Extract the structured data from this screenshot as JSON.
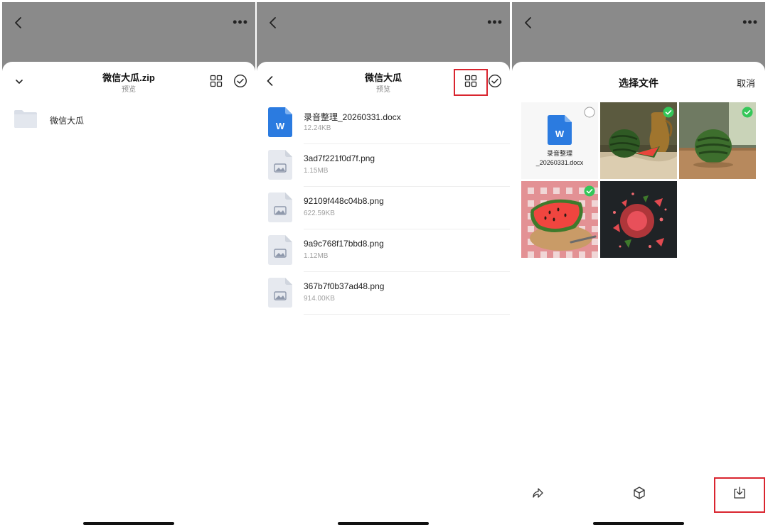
{
  "colors": {
    "accent_red": "#d9252f",
    "word_blue": "#2b7be0",
    "check_green": "#34c759",
    "overlay_gray": "#8a8a8a"
  },
  "icons": [
    "back-icon",
    "more-icon",
    "chevron-down-icon",
    "grid-view-icon",
    "select-check-icon",
    "folder-icon",
    "word-file-icon",
    "image-file-icon",
    "share-icon",
    "box-icon",
    "download-icon"
  ],
  "panel1": {
    "title": "微信大瓜.zip",
    "subtitle": "预览",
    "folder": {
      "name": "微信大瓜"
    }
  },
  "panel2": {
    "title": "微信大瓜",
    "subtitle": "预览",
    "files": [
      {
        "name": "录音整理_20260331.docx",
        "size": "12.24KB",
        "kind": "word"
      },
      {
        "name": "3ad7f221f0d7f.png",
        "size": "1.15MB",
        "kind": "image"
      },
      {
        "name": "92109f448c04b8.png",
        "size": "622.59KB",
        "kind": "image"
      },
      {
        "name": "9a9c768f17bbd8.png",
        "size": "1.12MB",
        "kind": "image"
      },
      {
        "name": "367b7f0b37ad48.png",
        "size": "914.00KB",
        "kind": "image"
      }
    ]
  },
  "panel3": {
    "title": "选择文件",
    "cancel": "取消",
    "doc_tile": {
      "line1": "录音整理",
      "line2": "_20260331.docx",
      "selected": false
    },
    "tiles": [
      {
        "name": "watermelon-jug-photo",
        "selected": true
      },
      {
        "name": "watermelon-table-photo",
        "selected": true
      },
      {
        "name": "watermelon-slice-picnic-photo",
        "selected": true
      },
      {
        "name": "watermelon-splash-photo",
        "selected": false
      }
    ]
  }
}
